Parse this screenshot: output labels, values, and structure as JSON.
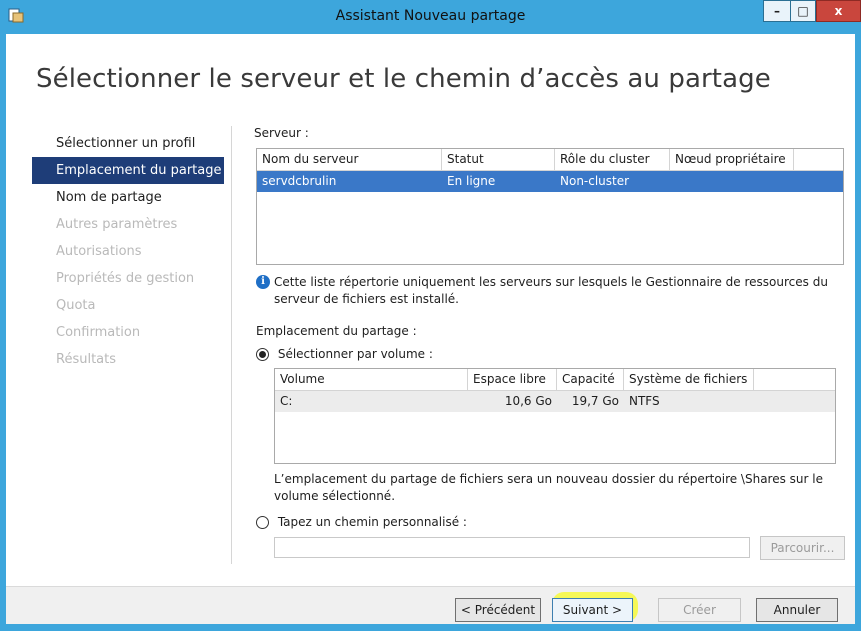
{
  "window": {
    "title": "Assistant Nouveau partage",
    "controls": {
      "minimize": "–",
      "maximize": "□",
      "close": "x"
    }
  },
  "page_heading": "Sélectionner le serveur et le chemin d’accès au partage",
  "nav": {
    "items": [
      {
        "label": "Sélectionner un profil",
        "state": "normal"
      },
      {
        "label": "Emplacement du partage",
        "state": "active"
      },
      {
        "label": "Nom de partage",
        "state": "normal"
      },
      {
        "label": "Autres paramètres",
        "state": "disabled"
      },
      {
        "label": "Autorisations",
        "state": "disabled"
      },
      {
        "label": "Propriétés de gestion",
        "state": "disabled"
      },
      {
        "label": "Quota",
        "state": "disabled"
      },
      {
        "label": "Confirmation",
        "state": "disabled"
      },
      {
        "label": "Résultats",
        "state": "disabled"
      }
    ]
  },
  "server_section": {
    "label": "Serveur :",
    "columns": [
      "Nom du serveur",
      "Statut",
      "Rôle du cluster",
      "Nœud propriétaire"
    ],
    "rows": [
      [
        "servdcbrulin",
        "En ligne",
        "Non-cluster",
        ""
      ]
    ]
  },
  "info_text": "Cette liste répertorie uniquement les serveurs sur lesquels le Gestionnaire de ressources du serveur de fichiers est installé.",
  "location_section": {
    "label": "Emplacement du partage :",
    "radio_volume": {
      "label": "Sélectionner par volume :",
      "checked": true
    },
    "volume_columns": [
      "Volume",
      "Espace libre",
      "Capacité",
      "Système de fichiers"
    ],
    "volume_rows": [
      [
        "C:",
        "10,6 Go",
        "19,7 Go",
        "NTFS"
      ]
    ],
    "volume_note": "L’emplacement du partage de fichiers sera un nouveau dossier du répertoire \\Shares sur le volume sélectionné.",
    "radio_custom": {
      "label": "Tapez un chemin personnalisé :",
      "checked": false
    },
    "custom_path_value": "",
    "browse_button": "Parcourir..."
  },
  "footer_buttons": {
    "previous": "< Précédent",
    "next": "Suivant >",
    "create": "Créer",
    "cancel": "Annuler"
  },
  "colors": {
    "titlebar": "#3da6dc",
    "nav_active": "#1e3d78",
    "row_selected": "#3a78c8",
    "highlight": "#f6f93c"
  }
}
